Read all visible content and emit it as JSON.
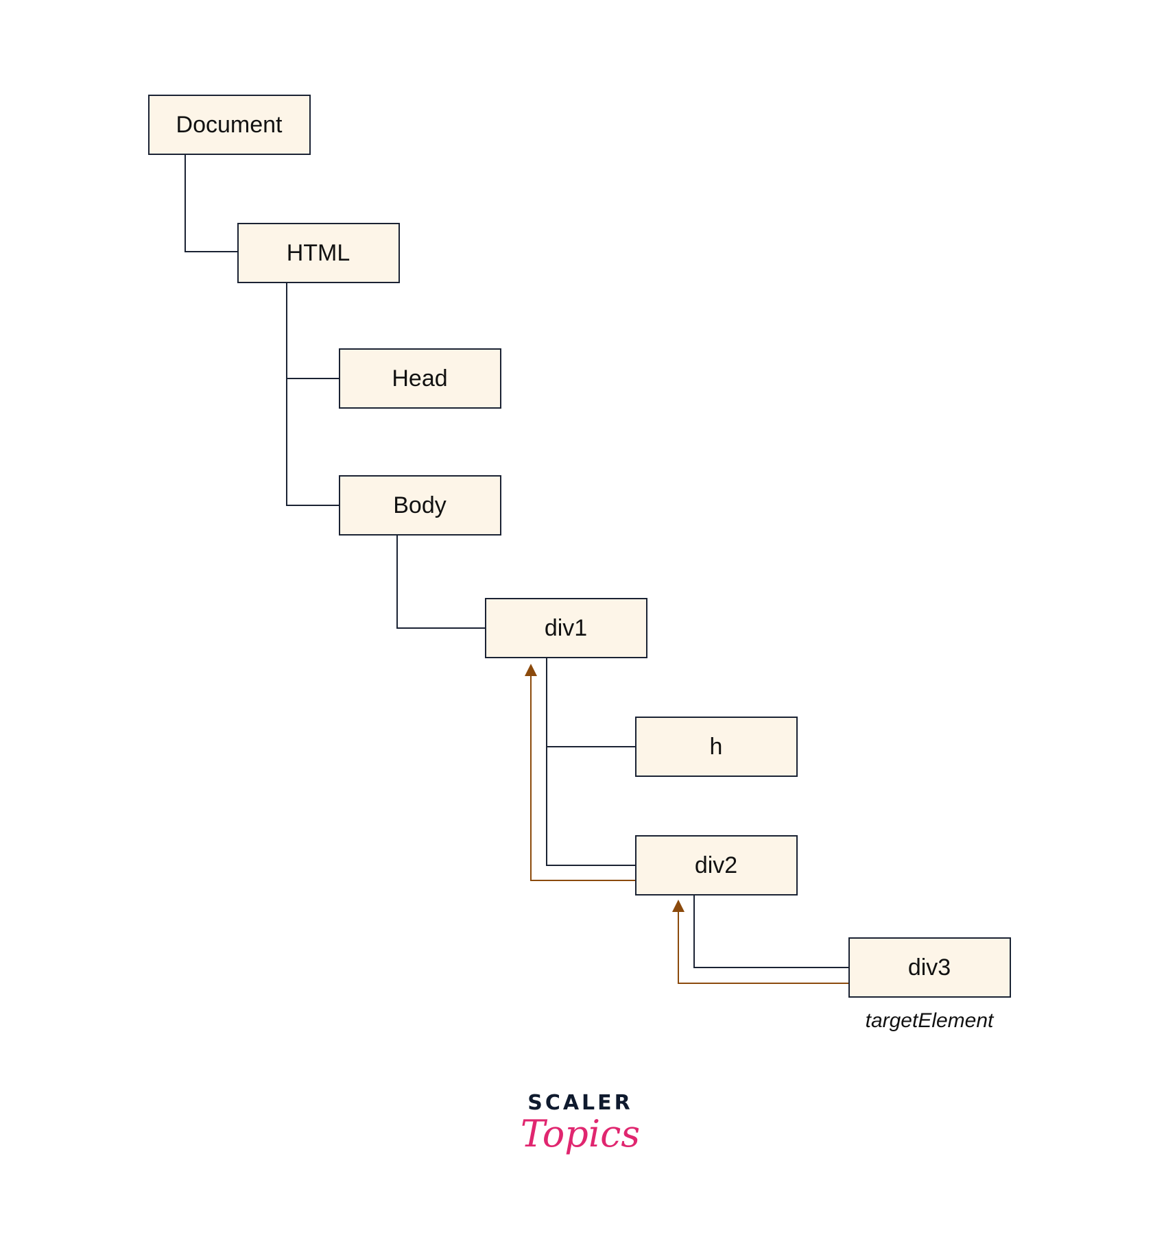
{
  "nodes": {
    "document": "Document",
    "html": "HTML",
    "head": "Head",
    "body": "Body",
    "div1": "div1",
    "h": "h",
    "div2": "div2",
    "div3": "div3"
  },
  "target_label": "targetElement",
  "logo": {
    "line1": "SCALER",
    "line2": "Topics"
  },
  "colors": {
    "node_fill": "#fdf5e8",
    "node_stroke": "#1a2233",
    "propagation_path": "#8b4a0c",
    "logo_accent": "#e0266f"
  }
}
